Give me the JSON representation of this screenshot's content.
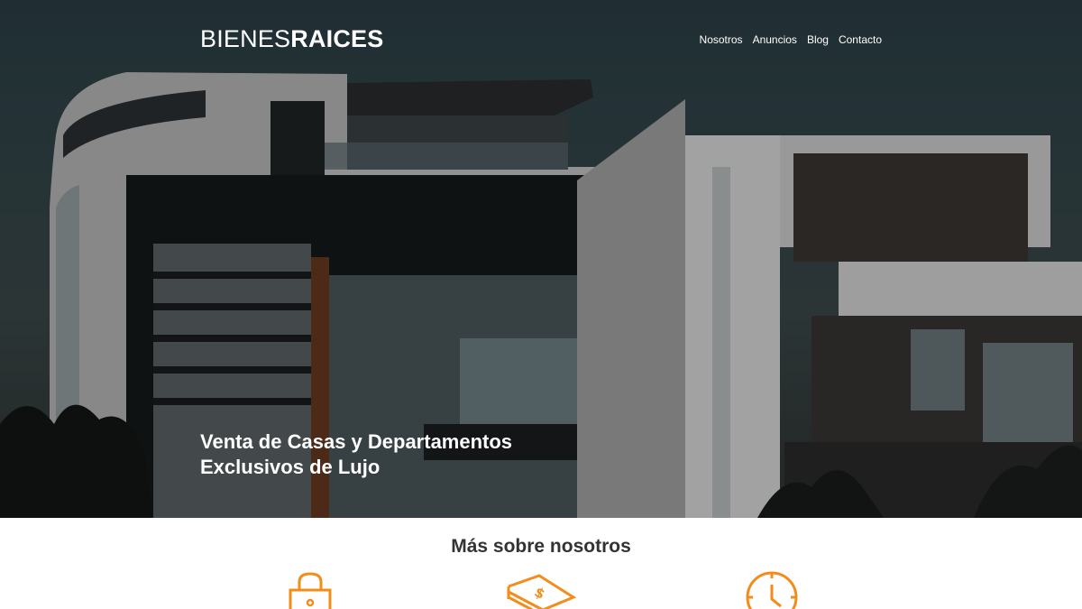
{
  "header": {
    "logo_light": "BIENES",
    "logo_bold": "RAICES",
    "nav": [
      "Nosotros",
      "Anuncios",
      "Blog",
      "Contacto"
    ]
  },
  "hero": {
    "title": "Venta de Casas y Departamentos Exclusivos de Lujo"
  },
  "about": {
    "title": "Más sobre nosotros",
    "icons": [
      "lock-icon",
      "money-icon",
      "clock-icon"
    ]
  },
  "colors": {
    "accent": "#f28c1b",
    "text_dark": "#333333",
    "hero_text": "#ffffff"
  }
}
